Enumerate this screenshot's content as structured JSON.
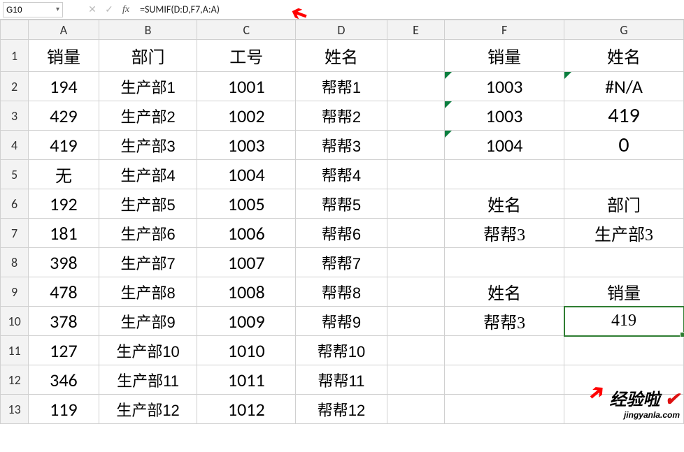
{
  "namebox": "G10",
  "formula": "=SUMIF(D:D,F7,A:A)",
  "columns": [
    "A",
    "B",
    "C",
    "D",
    "E",
    "F",
    "G"
  ],
  "rows": [
    {
      "n": "1",
      "A": "销量",
      "B": "部门",
      "C": "工号",
      "D": "姓名",
      "E": "",
      "F": "销量",
      "G": "姓名"
    },
    {
      "n": "2",
      "A": "194",
      "B": "生产部1",
      "C": "1001",
      "D": "帮帮1",
      "E": "",
      "F": "1003",
      "G": "#N/A",
      "triF": true,
      "triG": true,
      "GClass": "big"
    },
    {
      "n": "3",
      "A": "429",
      "B": "生产部2",
      "C": "1002",
      "D": "帮帮2",
      "E": "",
      "F": "1003",
      "G": "419",
      "triF": true,
      "GClass": "biggest"
    },
    {
      "n": "4",
      "A": "419",
      "B": "生产部3",
      "C": "1003",
      "D": "帮帮3",
      "E": "",
      "F": "1004",
      "G": "0",
      "triF": true,
      "GClass": "biggest"
    },
    {
      "n": "5",
      "A": "无",
      "B": "生产部4",
      "C": "1004",
      "D": "帮帮4",
      "E": "",
      "F": "",
      "G": ""
    },
    {
      "n": "6",
      "A": "192",
      "B": "生产部5",
      "C": "1005",
      "D": "帮帮5",
      "E": "",
      "F": "姓名",
      "G": "部门",
      "FGserif": true
    },
    {
      "n": "7",
      "A": "181",
      "B": "生产部6",
      "C": "1006",
      "D": "帮帮6",
      "E": "",
      "F": "帮帮3",
      "G": "生产部3",
      "FGserif": true
    },
    {
      "n": "8",
      "A": "398",
      "B": "生产部7",
      "C": "1007",
      "D": "帮帮7",
      "E": "",
      "F": "",
      "G": ""
    },
    {
      "n": "9",
      "A": "478",
      "B": "生产部8",
      "C": "1008",
      "D": "帮帮8",
      "E": "",
      "F": "姓名",
      "G": "销量",
      "FGserif": true
    },
    {
      "n": "10",
      "A": "378",
      "B": "生产部9",
      "C": "1009",
      "D": "帮帮9",
      "E": "",
      "F": "帮帮3",
      "G": "419",
      "FGserif": true,
      "sel": true
    },
    {
      "n": "11",
      "A": "127",
      "B": "生产部10",
      "C": "1010",
      "D": "帮帮10",
      "E": "",
      "F": "",
      "G": ""
    },
    {
      "n": "12",
      "A": "346",
      "B": "生产部11",
      "C": "1011",
      "D": "帮帮11",
      "E": "",
      "F": "",
      "G": ""
    },
    {
      "n": "13",
      "A": "119",
      "B": "生产部12",
      "C": "1012",
      "D": "帮帮12",
      "E": "",
      "F": "",
      "G": ""
    }
  ],
  "watermark": {
    "line1": "经验啦",
    "check": "✔",
    "line2": "jingyanla.com"
  }
}
